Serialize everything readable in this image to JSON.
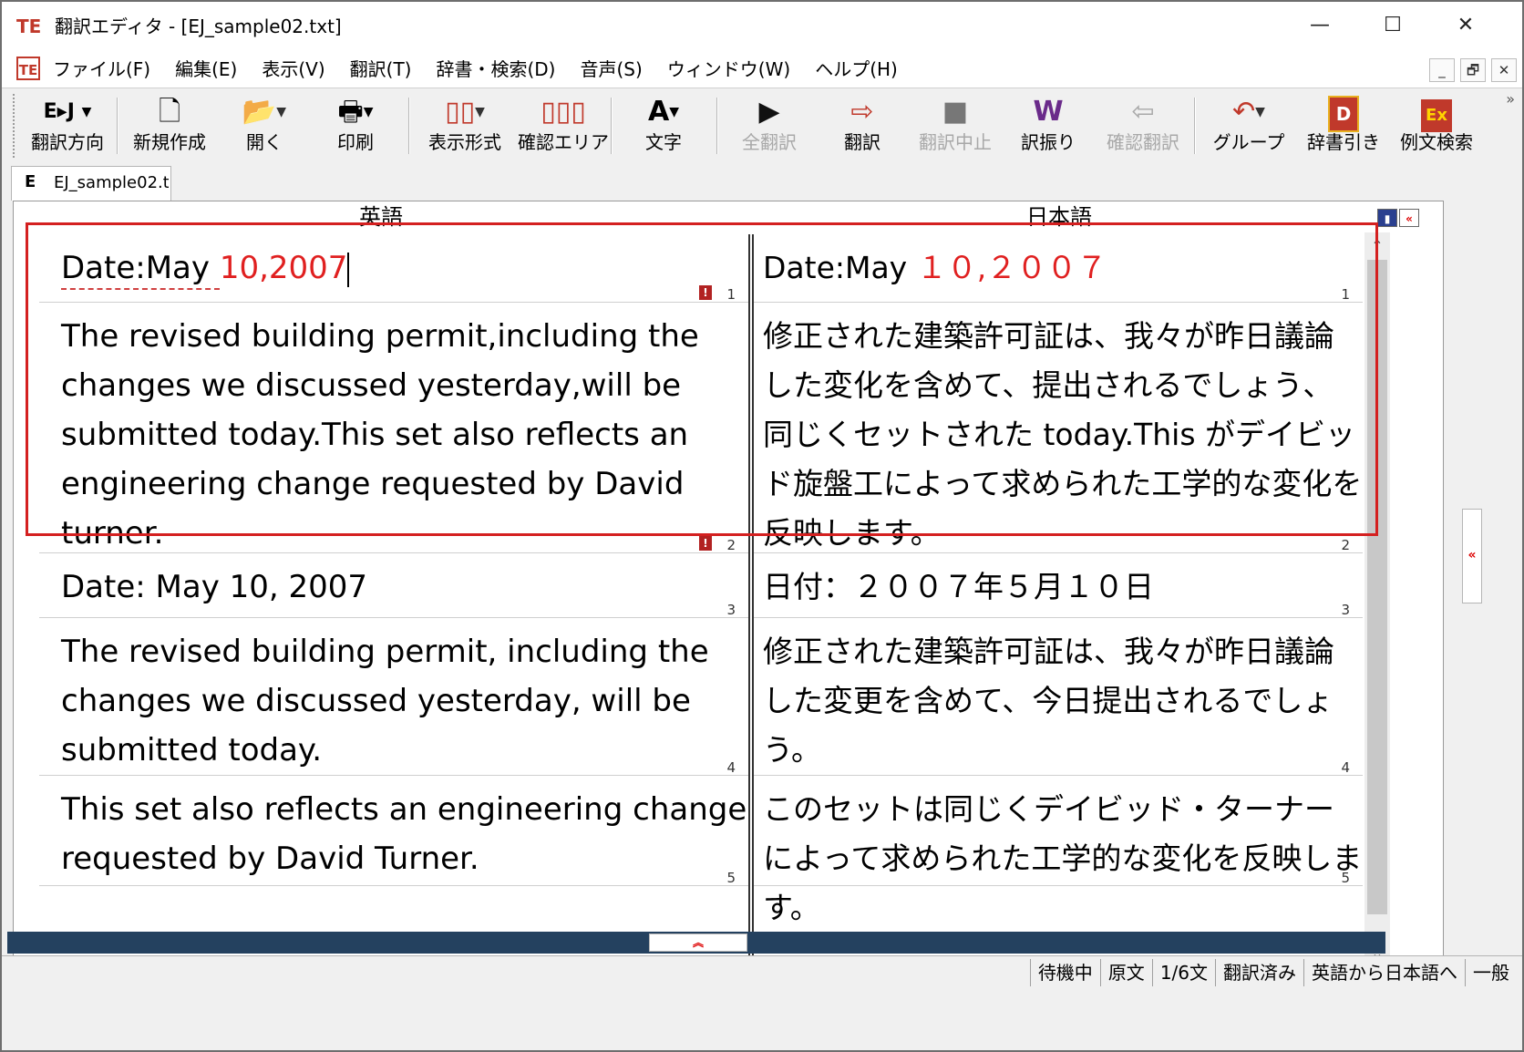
{
  "window": {
    "title": "翻訳エディタ - [EJ_sample02.txt]",
    "controls": {
      "minimize": "—",
      "maximize": "☐",
      "close": "✕"
    }
  },
  "menu": {
    "items": [
      "ファイル(F)",
      "編集(E)",
      "表示(V)",
      "翻訳(T)",
      "辞書・検索(D)",
      "音声(S)",
      "ウィンドウ(W)",
      "ヘルプ(H)"
    ],
    "mdi": {
      "minimize": "_",
      "restore": "🗗",
      "close": "✕"
    }
  },
  "toolbar": {
    "buttons": [
      {
        "icon": "E▸J",
        "label": "翻訳方向",
        "enabled": true
      },
      {
        "icon": "🗋",
        "label": "新規作成",
        "enabled": true
      },
      {
        "icon": "📂",
        "label": "開く",
        "enabled": true
      },
      {
        "icon": "🖶",
        "label": "印刷",
        "enabled": true
      },
      {
        "icon": "▯▯",
        "label": "表示形式",
        "enabled": true
      },
      {
        "icon": "▯▯▯",
        "label": "確認エリア",
        "enabled": true
      },
      {
        "icon": "A",
        "label": "文字",
        "enabled": true
      },
      {
        "icon": "▶",
        "label": "全翻訳",
        "enabled": false
      },
      {
        "icon": "⇨",
        "label": "翻訳",
        "enabled": true
      },
      {
        "icon": "■",
        "label": "翻訳中止",
        "enabled": false
      },
      {
        "icon": "W",
        "label": "訳振り",
        "enabled": true
      },
      {
        "icon": "⇦",
        "label": "確認翻訳",
        "enabled": false
      },
      {
        "icon": "↶",
        "label": "グループ",
        "enabled": true
      },
      {
        "icon": "D",
        "label": "辞書引き",
        "enabled": true
      },
      {
        "icon": "Ex",
        "label": "例文検索",
        "enabled": true
      }
    ],
    "overflow": "»"
  },
  "tab": {
    "letter": "E",
    "name": "EJ_sample02.t"
  },
  "editor": {
    "header_en": "英語",
    "header_ja": "日本語",
    "segments": [
      {
        "num": "1",
        "en_pre": "Date:May ",
        "en_red": "10,2007",
        "ja_pre": "Date:May ",
        "ja_red": "１０,２００７"
      },
      {
        "num": "2",
        "en": "The revised building permit,including the changes we discussed yesterday,will be submitted today.This set also reflects an engineering change requested by David turner.",
        "ja": "修正された建築許可証は、我々が昨日議論した変化を含めて、提出されるでしょう、同じくセットされた today.This がデイビッド旋盤工によって求められた工学的な変化を反映します。"
      },
      {
        "num": "3",
        "en": "Date: May 10, 2007",
        "ja": "日付：２００７年５月１０日"
      },
      {
        "num": "4",
        "en": "The revised building permit, including the changes we discussed yesterday, will be submitted today.",
        "ja": "修正された建築許可証は、我々が昨日議論した変更を含めて、今日提出されるでしょう。"
      },
      {
        "num": "5",
        "en": "This set also reflects an engineering change requested by David Turner.",
        "ja": "このセットは同じくデイビッド・ターナーによって求められた工学的な変化を反映します。"
      }
    ]
  },
  "status": [
    "待機中",
    "原文",
    "1/6文",
    "翻訳済み",
    "英語から日本語へ",
    "一般"
  ]
}
